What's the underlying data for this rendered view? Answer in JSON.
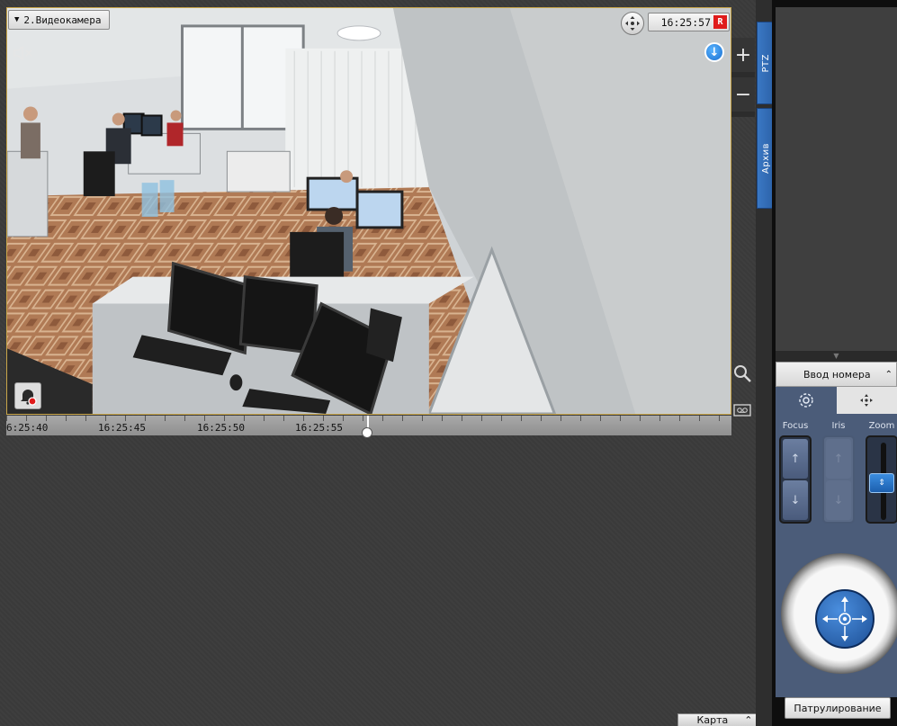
{
  "camera": {
    "title": "2.Видеокамера",
    "time": "16:25:57",
    "rec_indicator": "R"
  },
  "timeline": {
    "labels": [
      "6:25:40",
      "16:25:45",
      "16:25:50",
      "16:25:55"
    ]
  },
  "side_tabs": {
    "ptz": "PTZ",
    "archive": "Архив"
  },
  "ptz_panel": {
    "number_input_label": "Ввод номера",
    "focus_label": "Focus",
    "iris_label": "Iris",
    "zoom_label": "Zoom",
    "patrol_button": "Патрулирование"
  },
  "bottom_bar": {
    "map_button": "Карта"
  },
  "icons": {
    "camera_menu": "caret-down-icon",
    "mute": "speaker-muted-icon",
    "ptz_move": "ptz-move-icon",
    "download": "download-icon",
    "alarm": "alarm-bell-icon",
    "zoom_in": "plus-icon",
    "zoom_out": "minus-icon",
    "search": "search-icon",
    "archive": "archive-icon",
    "joystick": "joystick-icon"
  },
  "colors": {
    "tile_border": "#c9a64a",
    "rec": "#e01b1b",
    "tab_blue": "#3a78c4",
    "ptz_panel_bg": "#4b5c79"
  }
}
